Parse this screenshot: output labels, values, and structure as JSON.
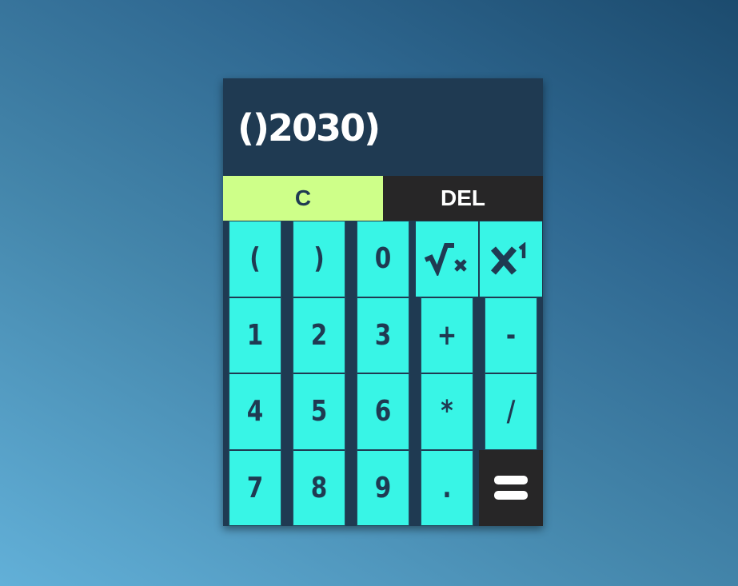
{
  "display": {
    "value": "()2030)"
  },
  "controls": {
    "clear_label": "C",
    "delete_label": "DEL"
  },
  "keys": {
    "open_paren": "(",
    "close_paren": ")",
    "zero": "0",
    "sqrt_icon": "square-root-icon",
    "power_icon": "power-icon",
    "one": "1",
    "two": "2",
    "three": "3",
    "plus": "+",
    "minus": "-",
    "four": "4",
    "five": "5",
    "six": "6",
    "multiply": "*",
    "divide": "/",
    "seven": "7",
    "eight": "8",
    "nine": "9",
    "dot": ".",
    "equals_icon": "equals-icon"
  },
  "colors": {
    "display_bg": "#1f3a52",
    "key_bg": "#38f5e6",
    "clear_bg": "#ceff89",
    "dark_key_bg": "#272627",
    "key_text": "#1f3a52"
  }
}
